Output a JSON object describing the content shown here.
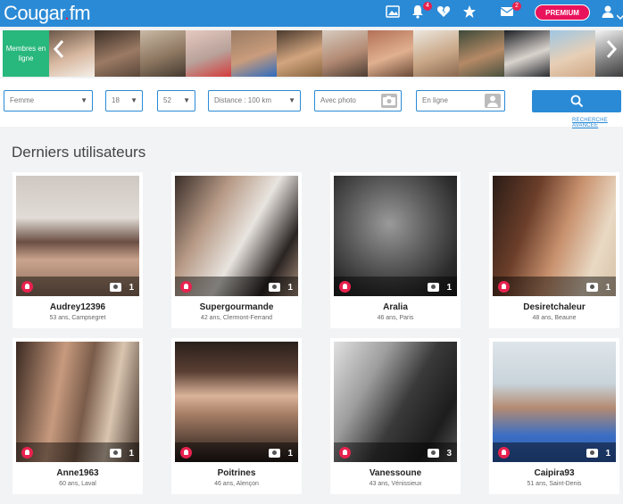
{
  "header": {
    "logo_main": "Cougar",
    "logo_dot": ".",
    "logo_tld": "fm",
    "notifications_count": "4",
    "messages_count": "2",
    "premium_label": "PREMIUM",
    "icons": [
      "photo-icon",
      "bell-icon",
      "broken-heart-icon",
      "star-icon",
      "mail-icon",
      "user-icon"
    ]
  },
  "strip": {
    "online_label": "Membres en ligne"
  },
  "filters": {
    "gender": "Femme",
    "age_min": "18",
    "age_max": "52",
    "distance": "Distance : 100 km",
    "with_photo": "Avec photo",
    "online": "En ligne",
    "advanced_search": "RECHERCHE AVANCÉE"
  },
  "section": {
    "title": "Derniers utilisateurs"
  },
  "users": [
    {
      "name": "Audrey12396",
      "info": "53 ans, Campsegret",
      "photos": "1"
    },
    {
      "name": "Supergourmande",
      "info": "42 ans, Clermont-Ferrand",
      "photos": "1"
    },
    {
      "name": "Aralia",
      "info": "46 ans, Paris",
      "photos": "1"
    },
    {
      "name": "Desiretchaleur",
      "info": "48 ans, Beaune",
      "photos": "1"
    },
    {
      "name": "Anne1963",
      "info": "60 ans, Laval",
      "photos": "1"
    },
    {
      "name": "Poitrines",
      "info": "46 ans, Alençon",
      "photos": "1"
    },
    {
      "name": "Vanessoune",
      "info": "43 ans, Vénissieux",
      "photos": "3"
    },
    {
      "name": "Caipira93",
      "info": "51 ans, Saint-Denis",
      "photos": "1"
    }
  ],
  "colors": {
    "brand_blue": "#2a8ad6",
    "accent_pink": "#e8135b",
    "online_green": "#28b77c"
  }
}
